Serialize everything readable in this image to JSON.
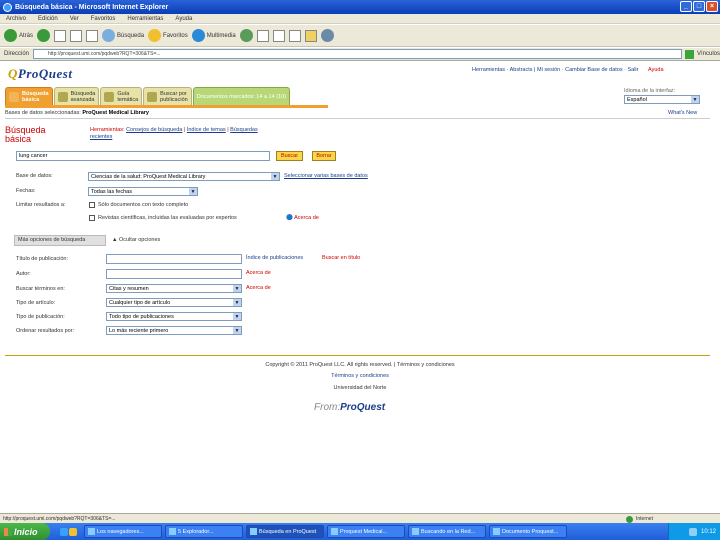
{
  "window": {
    "title": "Búsqueda básica - Microsoft Internet Explorer",
    "controls": [
      "_",
      "□",
      "×"
    ]
  },
  "menu": [
    "Archivo",
    "Edición",
    "Ver",
    "Favoritos",
    "Herramientas",
    "Ayuda"
  ],
  "toolbar": {
    "back": "Atrás",
    "search": "Búsqueda",
    "favorites": "Favoritos",
    "multimedia": "Multimedia"
  },
  "address": {
    "label": "Dirección",
    "url": "http://proquest.umi.com/pqdweb?RQT=306&TS=...",
    "go": "Ir",
    "links": "Vínculos"
  },
  "header": {
    "logo": "ProQuest",
    "toplinks": "Herramientas · Abstracts | Mi sesión · Cambiar Base de datos · Salir",
    "help": "Ayuda"
  },
  "tabs": [
    {
      "label1": "Búsqueda",
      "label2": "básica"
    },
    {
      "label1": "Búsqueda",
      "label2": "avanzada"
    },
    {
      "label1": "Guía",
      "label2": "temática"
    },
    {
      "label1": "Buscar por",
      "label2": "publicación"
    },
    {
      "label1": "Documentos marcados: 14 a 14 (10)",
      "label2": ""
    }
  ],
  "language": {
    "label": "Idioma de la interfaz:",
    "value": "Español"
  },
  "databases_line": {
    "prefix": "Bases de datos seleccionadas:",
    "value": "ProQuest Medical Library"
  },
  "whats_new": "What's New",
  "basic_search": {
    "title1": "Búsqueda",
    "title2": "básica",
    "tools_label": "Herramientas:",
    "tool1": "Consejos de búsqueda",
    "tool2": "Índice de temas",
    "tool3": "Búsquedas",
    "tool4": "recientes",
    "query": "lung cancer",
    "search_btn": "Buscar",
    "clear_btn": "Borrar"
  },
  "form": {
    "db_label": "Base de datos:",
    "db_value": "Ciencias de la salud: ProQuest Medical Library",
    "db_link": "Seleccionar varias bases de datos",
    "date_label": "Fechas:",
    "date_value": "Todas las fechas",
    "limit_label": "Limitar resultados a:",
    "limit1": "Sólo documentos con texto completo",
    "limit2": "Revistas científicas, incluidas las evaluadas por expertos",
    "about": "Acerca de",
    "more_label": "Más opciones de búsqueda",
    "fewer_label": "Ocultar opciones",
    "pub_label": "Título de publicación:",
    "pub_link1": "Índice de publicaciones",
    "pub_link2": "Buscar en título",
    "author_label": "Autor:",
    "author_link": "Acerca de",
    "terms_label": "Buscar términos en:",
    "terms_value": "Citas y resumen",
    "terms_link": "Acerca de",
    "article_label": "Tipo de artículo:",
    "article_value": "Cualquier tipo de artículo",
    "pubtype_label": "Tipo de publicación:",
    "pubtype_value": "Todo tipo de publicaciones",
    "sort_label": "Ordenar resultados por:",
    "sort_value": "Lo más reciente primero"
  },
  "footer": {
    "copyright": "Copyright © 2011 ProQuest LLC. All rights reserved. | Términos y condiciones",
    "terms": "Términos y condiciones",
    "library": "Universidad del Norte",
    "from": "From:",
    "brand": "ProQuest"
  },
  "status": {
    "text": "http://proquest.umi.com/pqdweb?RQT=306&TS=...",
    "zone": "Internet"
  },
  "taskbar": {
    "start": "Inicio",
    "tasks": [
      "Los navegadores...",
      "5 Explorador...",
      "Búsqueda en ProQuest",
      "Proquest Medical...",
      "Buscando en la Red...",
      "Documento Proquest..."
    ],
    "clock": "10:12"
  }
}
